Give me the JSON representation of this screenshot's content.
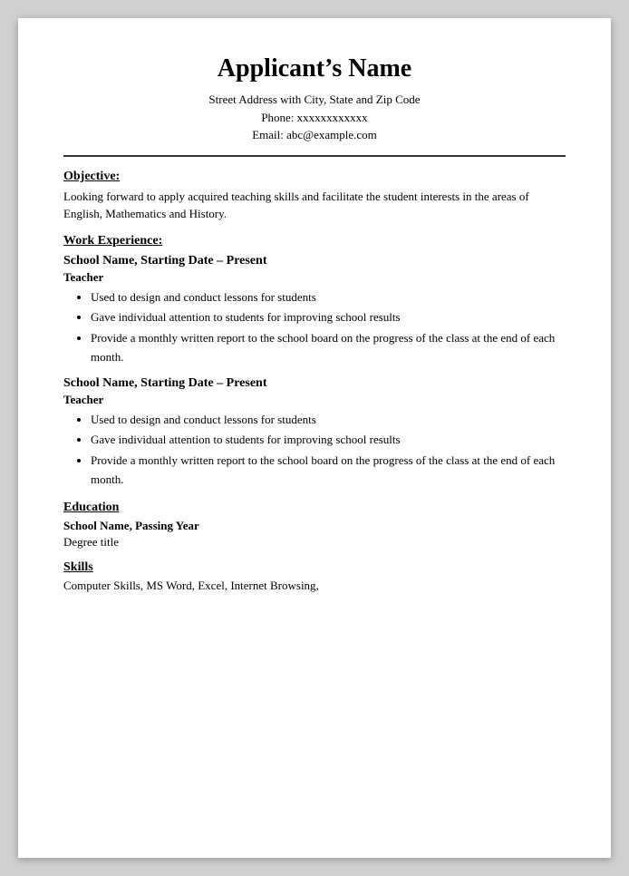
{
  "header": {
    "name": "Applicant’s Name",
    "address": "Street Address with City, State and Zip Code",
    "phone_label": "Phone: xxxxxxxxxxxx",
    "email_label": "Email: abc@example.com"
  },
  "sections": {
    "objective": {
      "title": "Objective:",
      "body": "Looking forward to apply acquired teaching skills and facilitate the student interests in the areas of English, Mathematics and History."
    },
    "work_experience": {
      "title": "Work Experience:",
      "jobs": [
        {
          "school_date": "School Name, Starting Date – Present",
          "role": "Teacher",
          "bullets": [
            "Used to design and conduct lessons for students",
            "Gave individual attention to students for improving school results",
            "Provide a monthly written report to the school board on the progress of the class at the end of each month."
          ]
        },
        {
          "school_date": "School Name, Starting Date – Present",
          "role": "Teacher",
          "bullets": [
            "Used to design and conduct lessons for students",
            "Gave individual attention to students for improving school results",
            "Provide a monthly written report to the school board on the progress of the class at the end of each month."
          ]
        }
      ]
    },
    "education": {
      "title": "Education",
      "school": "School Name, Passing Year",
      "degree": "Degree title"
    },
    "skills": {
      "title": "Skills",
      "body": "Computer Skills, MS Word, Excel, Internet Browsing,"
    }
  }
}
